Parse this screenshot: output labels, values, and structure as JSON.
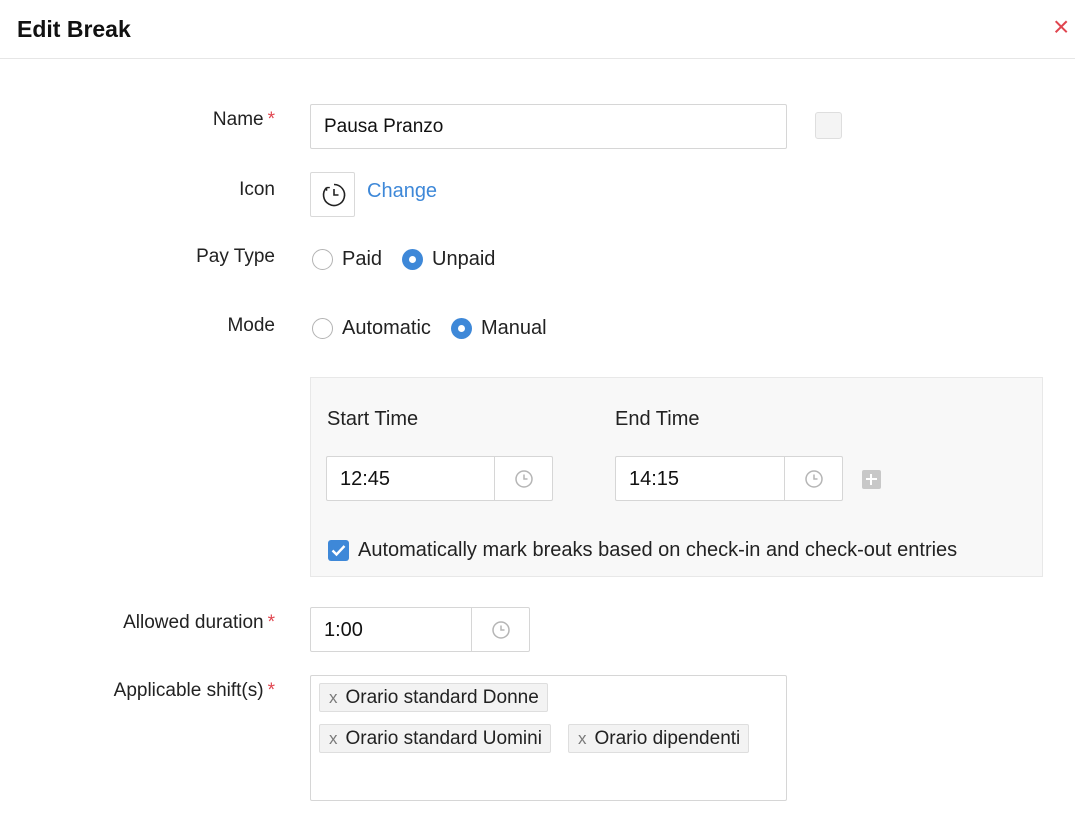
{
  "header": {
    "title": "Edit Break",
    "close_glyph": "×"
  },
  "form": {
    "name": {
      "label": "Name",
      "required_mark": "*",
      "value": "Pausa Pranzo"
    },
    "icon": {
      "label": "Icon",
      "icon_name": "clock-icon",
      "change_label": "Change"
    },
    "pay_type": {
      "label": "Pay Type",
      "options": [
        "Paid",
        "Unpaid"
      ],
      "selected": "Unpaid"
    },
    "mode": {
      "label": "Mode",
      "options": [
        "Automatic",
        "Manual"
      ],
      "selected": "Manual"
    },
    "manual_panel": {
      "start_time_label": "Start Time",
      "start_time_value": "12:45",
      "end_time_label": "End Time",
      "end_time_value": "14:15",
      "auto_mark_checked": true,
      "auto_mark_label": "Automatically mark breaks based on check-in and check-out entries"
    },
    "allowed_duration": {
      "label": "Allowed duration",
      "required_mark": "*",
      "value": "1:00"
    },
    "applicable_shifts": {
      "label": "Applicable shift(s)",
      "required_mark": "*",
      "remove_glyph": "x",
      "tags": [
        "Orario standard Donne",
        "Orario standard Uomini",
        "Orario dipendenti"
      ]
    }
  },
  "colors": {
    "accent": "#3e88d8",
    "required": "#e0454f",
    "panel_bg": "#f8f8f8"
  }
}
